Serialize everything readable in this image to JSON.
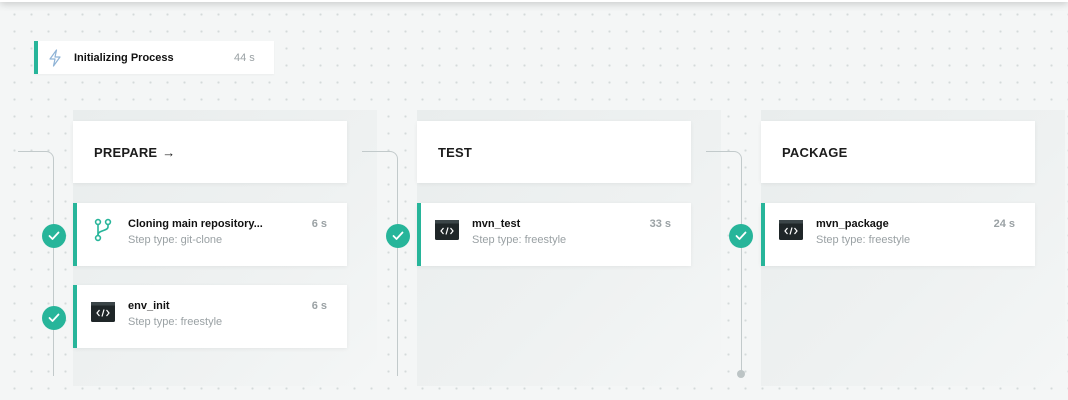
{
  "init": {
    "title": "Initializing Process",
    "duration": "44 s",
    "icon": "lightning-icon"
  },
  "colors": {
    "success": "#27b59a",
    "line": "#c2cacb",
    "text_muted": "#9aa1a4"
  },
  "stages": [
    {
      "label": "PREPARE",
      "arrow": "→",
      "steps": [
        {
          "name": "Cloning main repository...",
          "type": "Step type: git-clone",
          "duration": "6 s",
          "icon": "git-branch-icon",
          "status": "success"
        },
        {
          "name": "env_init",
          "type": "Step type: freestyle",
          "duration": "6 s",
          "icon": "code-terminal-icon",
          "status": "success"
        }
      ]
    },
    {
      "label": "TEST",
      "steps": [
        {
          "name": "mvn_test",
          "type": "Step type: freestyle",
          "duration": "33 s",
          "icon": "code-terminal-icon",
          "status": "success"
        }
      ]
    },
    {
      "label": "PACKAGE",
      "steps": [
        {
          "name": "mvn_package",
          "type": "Step type: freestyle",
          "duration": "24 s",
          "icon": "code-terminal-icon",
          "status": "success"
        }
      ]
    }
  ]
}
